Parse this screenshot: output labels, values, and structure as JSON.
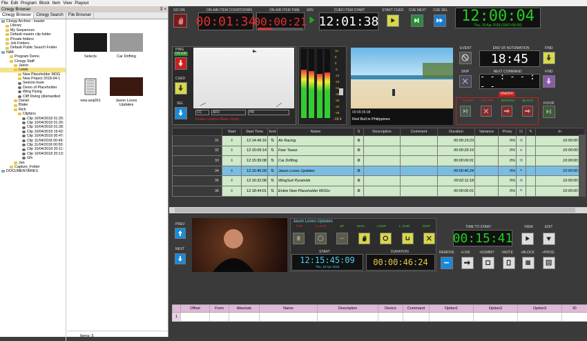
{
  "menu": [
    "File",
    "Edit",
    "Program",
    "Block",
    "Item",
    "View",
    "Playout"
  ],
  "browser": {
    "title": "Cinegy Browser",
    "pin": "⊼ ×",
    "tabs": [
      "Cinegy Browser",
      "Cinegy Search",
      "File Browser"
    ],
    "tree": [
      {
        "t": "Cinegy Archive : master",
        "d": 0,
        "i": "disk"
      },
      {
        "t": "Library",
        "d": 1,
        "i": "fold"
      },
      {
        "t": "My Sequences",
        "d": 1,
        "i": "fold"
      },
      {
        "t": "Default master clip folder",
        "d": 1,
        "i": "fold"
      },
      {
        "t": "Private folders",
        "d": 1,
        "i": "fold"
      },
      {
        "t": "Job Folders",
        "d": 1,
        "i": "fold"
      },
      {
        "t": "Default Public Search Folder",
        "d": 1,
        "i": "fold"
      },
      {
        "t": "NAB",
        "d": 0,
        "i": "disk"
      },
      {
        "t": "Program Demo",
        "d": 2,
        "i": "fold"
      },
      {
        "t": "Cinegy Staff",
        "d": 2,
        "i": "fold"
      },
      {
        "t": "Jason",
        "d": 3,
        "i": "fold"
      },
      {
        "t": "Lewis",
        "d": 3,
        "i": "fold"
      },
      {
        "t": "New Placeholder MOG",
        "d": 4,
        "i": "fold"
      },
      {
        "t": "New Project 2018-04-1",
        "d": 4,
        "i": "fold"
      },
      {
        "t": "Selects-mute",
        "d": 4,
        "i": "clipi"
      },
      {
        "t": "Demo of Placeholder",
        "d": 4,
        "i": "clipi"
      },
      {
        "t": "Wing Flying",
        "d": 4,
        "i": "clipi"
      },
      {
        "t": "Cliff Diving (dismantled",
        "d": 4,
        "i": "clipi"
      },
      {
        "t": "Daniel",
        "d": 3,
        "i": "fold"
      },
      {
        "t": "Blake",
        "d": 3,
        "i": "fold"
      },
      {
        "t": "Rich",
        "d": 3,
        "i": "fold"
      },
      {
        "t": "Clipbins",
        "d": 4,
        "i": "fold"
      },
      {
        "t": "Clip 10/04/2018 01:25:",
        "d": 5,
        "i": "clipi"
      },
      {
        "t": "Clip 10/04/2018 01:26:",
        "d": 5,
        "i": "clipi"
      },
      {
        "t": "Clip 10/04/2018 01:28:",
        "d": 5,
        "i": "clipi"
      },
      {
        "t": "Clip 10/04/2018 19:42:",
        "d": 5,
        "i": "clipi"
      },
      {
        "t": "Clip 10/04/2018 00:47:",
        "d": 5,
        "i": "clipi"
      },
      {
        "t": "Clip 11/04/2018 00:49:",
        "d": 5,
        "i": "clipi"
      },
      {
        "t": "Clip 11/04/2018 00:50:",
        "d": 5,
        "i": "clipi"
      },
      {
        "t": "Clip 10/04/2018 20:11:",
        "d": 5,
        "i": "clipi"
      },
      {
        "t": "Clip 10/04/2018 20:13:",
        "d": 5,
        "i": "clipi"
      },
      {
        "t": "Gfx",
        "d": 5,
        "i": "clipi"
      },
      {
        "t": "Jan",
        "d": 3,
        "i": "fold"
      },
      {
        "t": "Capture_Folder",
        "d": 2,
        "i": "fold"
      },
      {
        "t": "DOCUMENTARIES",
        "d": 0,
        "i": "disk"
      }
    ],
    "thumbs": [
      {
        "label": "Selects",
        "bg": "#1a1a1a"
      },
      {
        "label": "Car Drifting",
        "bg": "#9a9a9a"
      },
      {
        "label": "new.seq001",
        "bg": "#fff"
      },
      {
        "label": "Jason Loves Updates",
        "bg": "#3a1a10"
      }
    ],
    "items": "Items: 5"
  },
  "top": {
    "go_on": "GO ON",
    "countdown_label": "ON-AIR ITEM COUNTDOWN",
    "countdown": "00:01:34",
    "onair_time_label": "ON-AIR ITEM TIME",
    "onair_time": "00:00:21",
    "srv": "SRV",
    "cued_start_label": "CUED ITEM START",
    "cued_start": "12:01:38",
    "start_cued": "START CUED",
    "cue_next": "CUE NEXT",
    "cue_sel": "CUE SEL",
    "clock": "12:00:04",
    "clock_date": "Thu, 19 Apr 2018 (GMT+00:00)"
  },
  "mid": {
    "ping": "PING",
    "on_air": "ON AIR",
    "cued": "CUED",
    "sel": "SEL",
    "preview_tags": [
      "CC",
      "AFD",
      "PR"
    ],
    "preview_caption": "Kuala Lumpur Base Jump",
    "meter_vals": [
      "12",
      "6",
      "0",
      "-6",
      "-12",
      "-18",
      "-24",
      "-30",
      "-36",
      "-42",
      "-48"
    ],
    "meter_readout": "-18.4",
    "video_time": "00:09:35:08",
    "video_caption": "Red Bull in Philippines",
    "event": "EVENT",
    "end_auto_label": "END OF AUTOMATION",
    "end_auto": "18:45",
    "find": "FIND",
    "skip": "SKIP",
    "next_cmd_label": "NEXT COMMAND",
    "next_cmd": "- - : - - : - -",
    "onoff": "ON/OFF",
    "modes": [
      "COMM",
      "CG OFF",
      "BYPASS",
      "BLACK"
    ],
    "fovr": "F/OVR"
  },
  "playlist": {
    "headers": [
      "",
      "Start",
      "Start Time",
      "End",
      "Name",
      "S",
      "Description",
      "Comment",
      "Duration",
      "Variance",
      "Proxy",
      "☑",
      "✎",
      "In"
    ],
    "rows": [
      {
        "n": "31",
        "t": "12:14:49:16",
        "name": "Air Racing",
        "dur": "00:00:19:23",
        "proxy": "0%",
        "in": "10:00:00:00",
        "blue": true
      },
      {
        "n": "32",
        "t": "12:15:09:14",
        "name": "Fear Tease",
        "dur": "00:00:29:19",
        "proxy": "0%",
        "in": "10:00:00:00",
        "blue": false
      },
      {
        "n": "33",
        "t": "12:15:39:08",
        "name": "Car Drifting",
        "dur": "00:00:06:01",
        "proxy": "0%",
        "in": "10:00:00:00",
        "blue": false
      },
      {
        "n": "34",
        "t": "12:15:45:09",
        "name": "Jason Loves Updates",
        "dur": "00:00:46:24",
        "proxy": "0%",
        "in": "10:00:00:00",
        "blue": true,
        "sel": true
      },
      {
        "n": "35",
        "t": "12:16:32:08",
        "name": "WingSuit Pyramids",
        "dur": "00:02:11:18",
        "proxy": "0%",
        "in": "10:00:00:00",
        "blue": false
      },
      {
        "n": "36",
        "t": "12:18:44:01",
        "name": "Entire New Placeholder MOGs",
        "dur": "00:00:06:01",
        "proxy": "0%",
        "in": "10:00:00:00",
        "blue": false
      }
    ]
  },
  "bottom": {
    "prev": "PREV",
    "next": "NEXT",
    "item_title": "Jason Loves Updates",
    "flags": [
      "FIW",
      "CLOCK",
      "JIP",
      "MAN",
      "LOOP",
      "L. END",
      "SKIP"
    ],
    "start_label": "START",
    "start": "12:15:45:09",
    "start_date": "Thu, 19 Apr 2018",
    "duration_label": "DURATION",
    "duration": "00:00:46:24",
    "tts_label": "TIME TO START",
    "tts": "00:15:41",
    "view": "VIEW",
    "edit": "EDIT",
    "remove": "REMOVE",
    "plus_live": "+LIVE",
    "plus_dummy": "+DUMMY",
    "plus_note": "+NOTE",
    "plus_block": "+BLOCK",
    "plus_prog": "+PROG"
  },
  "events": {
    "headers": [
      "",
      "Offset",
      "From",
      "Absolute",
      "Name",
      "Description",
      "Device",
      "Command",
      "Option1",
      "Option2",
      "Option3",
      "ID"
    ],
    "row": "1"
  }
}
